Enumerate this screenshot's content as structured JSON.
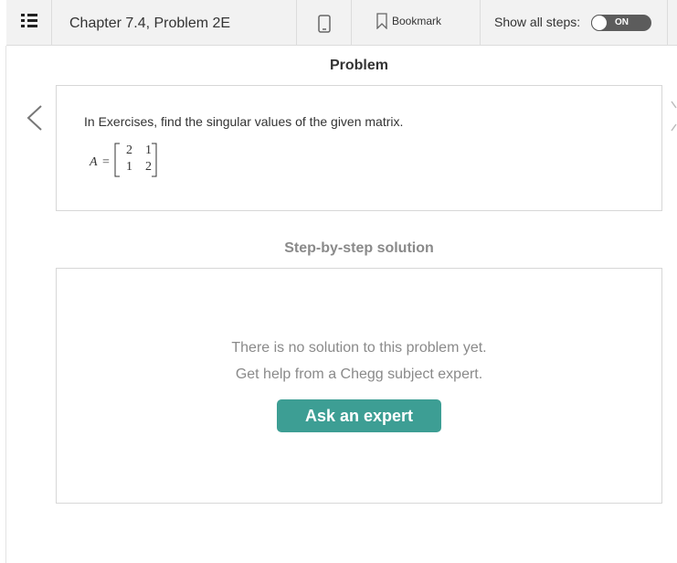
{
  "header": {
    "chapter_title": "Chapter 7.4, Problem 2E",
    "bookmark_label": "Bookmark",
    "show_steps_label": "Show all steps:",
    "toggle_state": "ON"
  },
  "problem": {
    "section_title": "Problem",
    "text": "In Exercises, find the singular values of the given matrix.",
    "matrix_var": "A",
    "equals": "=",
    "matrix": [
      [
        "2",
        "1"
      ],
      [
        "1",
        "2"
      ]
    ]
  },
  "solution": {
    "section_title": "Step-by-step solution",
    "no_solution_text": "There is no solution to this problem yet.",
    "help_text": "Get help from a Chegg subject expert.",
    "ask_button_label": "Ask an expert"
  },
  "icons": [
    "menu-icon",
    "mobile-phone-icon",
    "bookmark-icon",
    "chevron-left-icon"
  ],
  "colors": {
    "accent": "#3d9e94",
    "toggle": "#5c5c5c",
    "muted_text": "#8a8a8a"
  }
}
